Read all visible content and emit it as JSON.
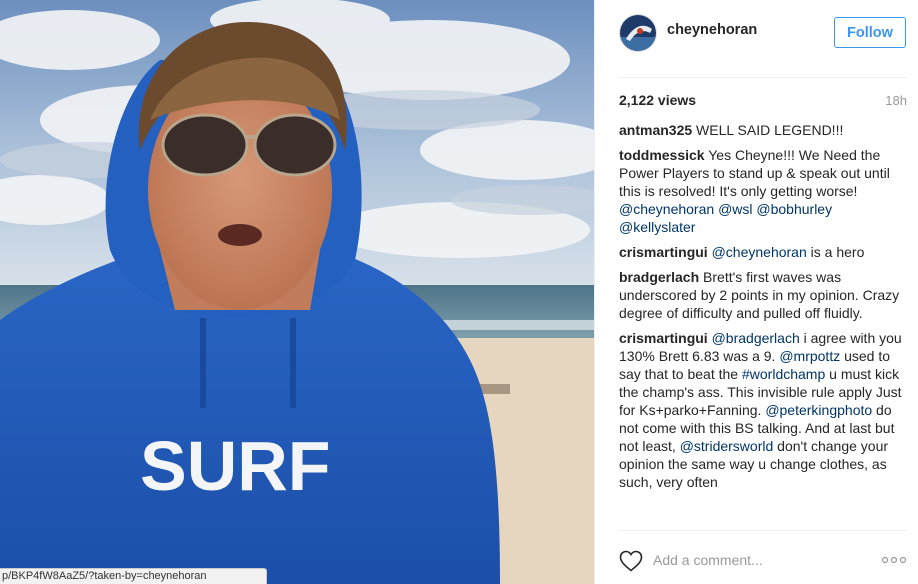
{
  "media": {
    "shirt_text": "SURF",
    "status_url": "p/BKP4fW8AaZ5/?taken-by=cheynehoran"
  },
  "header": {
    "username": "cheynehoran",
    "follow_label": "Follow"
  },
  "meta": {
    "views": "2,122 views",
    "age": "18h"
  },
  "comments": [
    {
      "user": "antman325",
      "parts": [
        {
          "text": "WELL SAID LEGEND!!!",
          "mention": false
        }
      ]
    },
    {
      "user": "toddmessick",
      "parts": [
        {
          "text": "Yes Cheyne!!! We Need the Power Players to stand up & speak out until this is resolved! It's only getting worse! ",
          "mention": false
        },
        {
          "text": "@cheynehoran",
          "mention": true
        },
        {
          "text": " ",
          "mention": false
        },
        {
          "text": "@wsl",
          "mention": true
        },
        {
          "text": " ",
          "mention": false
        },
        {
          "text": "@bobhurley",
          "mention": true
        },
        {
          "text": " ",
          "mention": false
        },
        {
          "text": "@kellyslater",
          "mention": true
        }
      ]
    },
    {
      "user": "crismartingui",
      "parts": [
        {
          "text": "@cheynehoran",
          "mention": true
        },
        {
          "text": " is a hero",
          "mention": false
        }
      ]
    },
    {
      "user": "bradgerlach",
      "parts": [
        {
          "text": "Brett's first waves was underscored by 2 points in my opinion. Crazy degree of difficulty and pulled off fluidly.",
          "mention": false
        }
      ]
    },
    {
      "user": "crismartingui",
      "parts": [
        {
          "text": "@bradgerlach",
          "mention": true
        },
        {
          "text": " i agree with you 130%  Brett 6.83 was a 9. ",
          "mention": false
        },
        {
          "text": "@mrpottz",
          "mention": true
        },
        {
          "text": " used to say that to beat the ",
          "mention": false
        },
        {
          "text": "#worldchamp",
          "mention": true
        },
        {
          "text": " u must kick the champ's ass. This invisible rule apply Just for Ks+parko+Fanning. ",
          "mention": false
        },
        {
          "text": "@peterkingphoto",
          "mention": true
        },
        {
          "text": " do not come with this BS talking. And at last but not least, ",
          "mention": false
        },
        {
          "text": "@stridersworld",
          "mention": true
        },
        {
          "text": " don't change your opinion the same way u change clothes, as such, very often",
          "mention": false
        }
      ]
    }
  ],
  "footer": {
    "comment_placeholder": "Add a comment..."
  },
  "colors": {
    "accent": "#3897f0",
    "mention": "#003569",
    "hoodie": "#1d56b8"
  },
  "icons": {
    "like": "heart-icon",
    "more": "more-options-icon"
  }
}
